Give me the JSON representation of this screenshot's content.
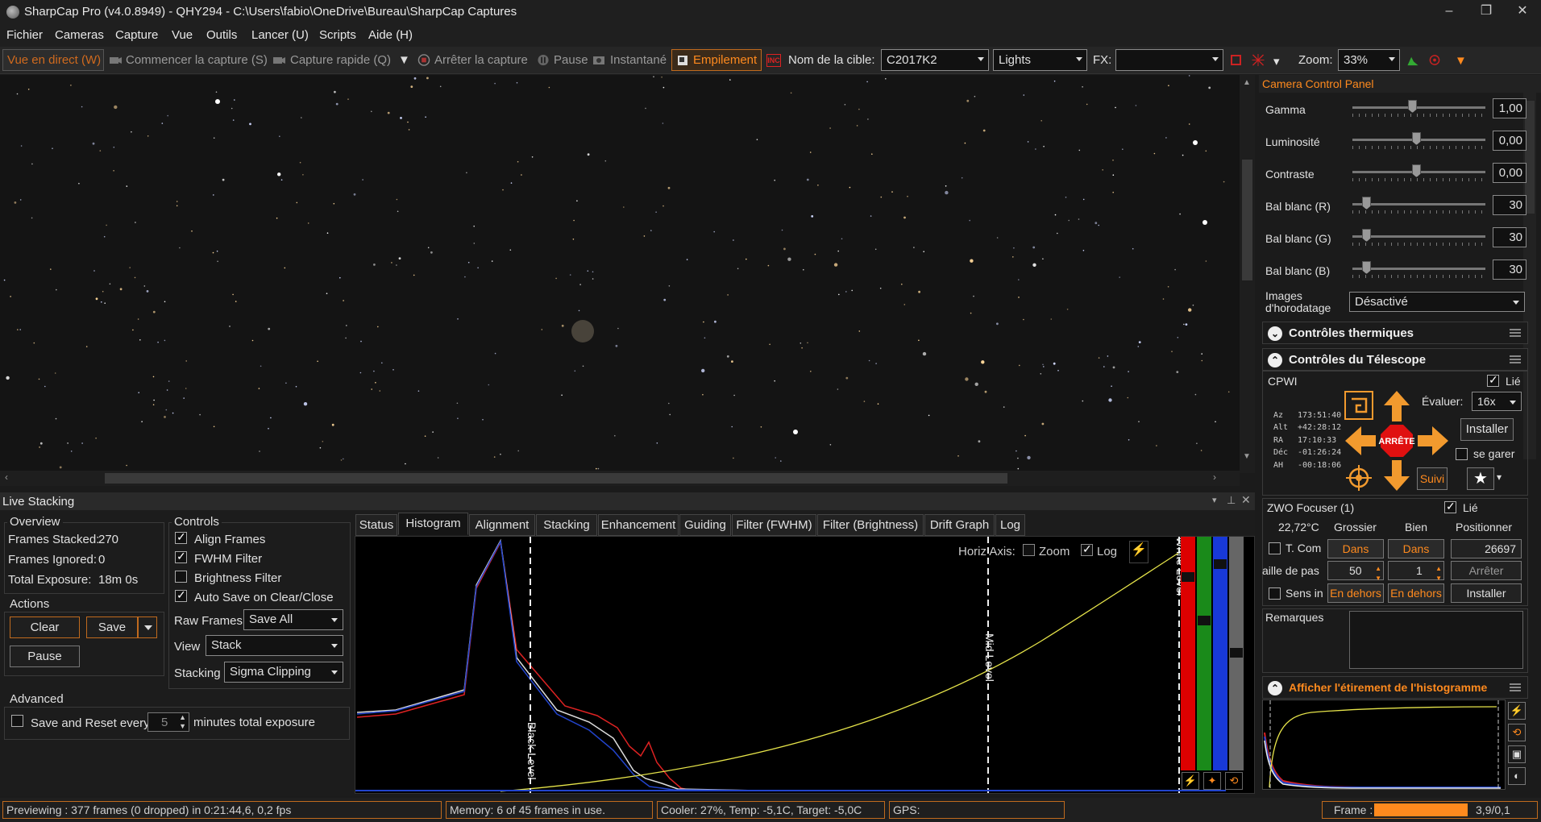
{
  "window": {
    "title": "SharpCap Pro (v4.0.8949) - QHY294 - C:\\Users\\fabio\\OneDrive\\Bureau\\SharpCap Captures",
    "minimize": "–",
    "maximize": "❐",
    "close": "✕"
  },
  "menu": [
    "Fichier",
    "Cameras",
    "Capture",
    "Vue",
    "Outils",
    "Lancer (U)",
    "Scripts",
    "Aide (H)"
  ],
  "toolbar": {
    "live_view": "Vue en direct (W)",
    "start_capture": "Commencer la capture (S)",
    "quick_capture": "Capture rapide (Q)",
    "stop_capture": "Arrêter la capture",
    "pause": "Pause",
    "snapshot": "Instantané",
    "stacking": "Empilement",
    "target_label": "Nom de la cible:",
    "target_value": "C2017K2",
    "frame_type": "Lights",
    "fx_label": "FX:",
    "fx_value": "",
    "zoom_label": "Zoom:",
    "zoom_value": "33%"
  },
  "live_stacking": {
    "title": "Live Stacking",
    "overview": {
      "label": "Overview",
      "frames_stacked_label": "Frames Stacked:",
      "frames_stacked": "270",
      "frames_ignored_label": "Frames Ignored:",
      "frames_ignored": "0",
      "total_exposure_label": "Total Exposure:",
      "total_exposure": "18m 0s"
    },
    "actions": {
      "label": "Actions",
      "clear": "Clear",
      "save": "Save",
      "pause": "Pause"
    },
    "advanced": {
      "label": "Advanced",
      "save_reset": "Save and Reset every",
      "minutes": "5",
      "minutes_suffix": "minutes total exposure"
    },
    "controls": {
      "label": "Controls",
      "align_frames": "Align Frames",
      "fwhm_filter": "FWHM Filter",
      "brightness_filter": "Brightness Filter",
      "auto_save": "Auto Save on Clear/Close",
      "raw_frames_label": "Raw Frames",
      "raw_frames_value": "Save All",
      "view_label": "View",
      "view_value": "Stack",
      "stacking_label": "Stacking",
      "stacking_value": "Sigma Clipping"
    },
    "tabs": [
      "Status",
      "Histogram",
      "Alignment",
      "Stacking",
      "Enhancement",
      "Guiding",
      "Filter (FWHM)",
      "Filter (Brightness)",
      "Drift Graph",
      "Log"
    ],
    "histogram": {
      "horiz_axis": "Horiz Axis:",
      "zoom": "Zoom",
      "log": "Log",
      "black_level": "Black Level",
      "mid_level": "Mid Level",
      "white_level": "White Level"
    }
  },
  "status": {
    "previewing": "Previewing : 377 frames (0 dropped) in 0:21:44,6, 0,2 fps",
    "memory": "Memory: 6 of 45 frames in use.",
    "cooler": "Cooler: 27%, Temp: -5,1C, Target: -5,0C",
    "gps": "GPS:",
    "frame_label": "Frame :",
    "frame_value": "3,9/0,1"
  },
  "camera_panel": {
    "title": "Camera Control Panel",
    "gamma_label": "Gamma",
    "gamma": "1,00",
    "brightness_label": "Luminosité",
    "brightness": "0,00",
    "contrast_label": "Contraste",
    "contrast": "0,00",
    "wb_r_label": "Bal blanc (R)",
    "wb_r": "30",
    "wb_g_label": "Bal blanc (G)",
    "wb_g": "30",
    "wb_b_label": "Bal blanc (B)",
    "wb_b": "30",
    "timestamp_label_1": "Images",
    "timestamp_label_2": "d'horodatage",
    "timestamp_value": "Désactivé"
  },
  "thermal": {
    "title": "Contrôles thermiques"
  },
  "telescope": {
    "title": "Contrôles du Télescope",
    "mount": "CPWI",
    "linked": "Lié",
    "rate_label": "Évaluer:",
    "rate_value": "16x",
    "setup": "Installer",
    "park": "se garer",
    "track": "Suivi",
    "stop": "ARRÊTE",
    "coords": [
      [
        "Az",
        "173:51:40"
      ],
      [
        "Alt",
        "+42:28:12"
      ],
      [
        "RA",
        "17:10:33"
      ],
      [
        "Déc",
        "-01:26:24"
      ],
      [
        "AH",
        "-00:18:06"
      ]
    ]
  },
  "focuser": {
    "title": "ZWO Focuser (1)",
    "linked": "Lié",
    "temp": "22,72°C",
    "coarse": "Grossier",
    "fine": "Bien",
    "position_label": "Positionner",
    "tcomp": "T. Com",
    "step_label": "aille de pas",
    "in": "Dans",
    "out": "En dehors",
    "position": "26697",
    "coarse_step": "50",
    "fine_step": "1",
    "stop": "Arrêter",
    "reverse": "Sens in",
    "setup": "Installer",
    "notes": "Remarques"
  },
  "histo_stretch": {
    "title": "Afficher l'étirement de l'histogramme"
  },
  "colors": {
    "accent": "#ff8a1e",
    "border_orange": "#c06a1e"
  }
}
